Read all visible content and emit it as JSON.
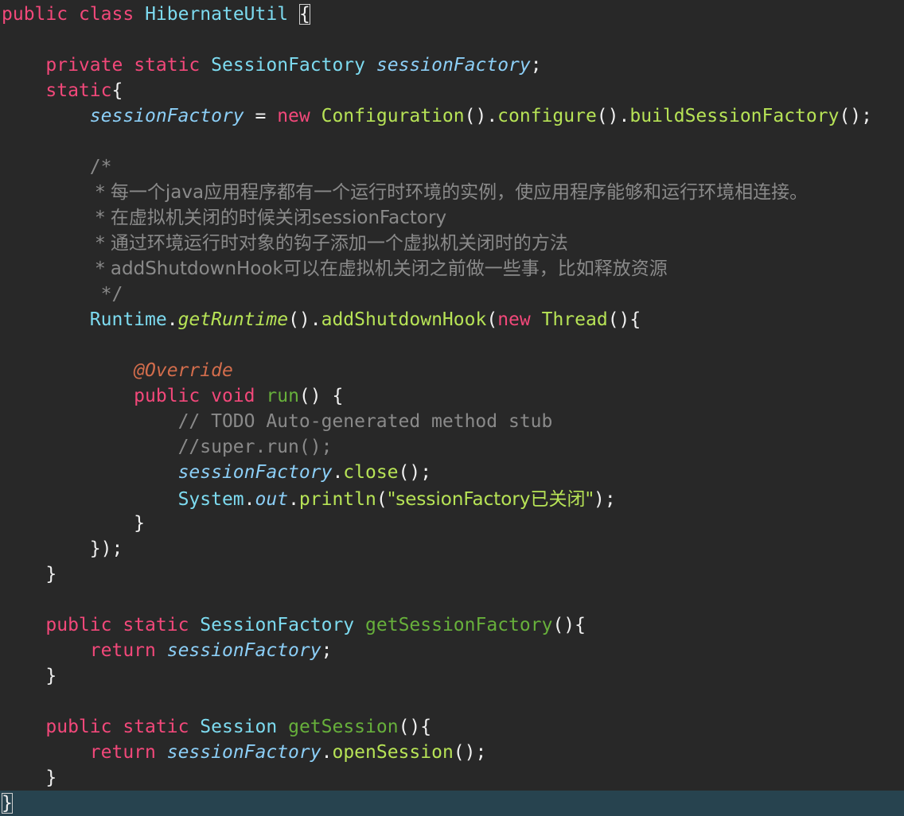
{
  "colors": {
    "background": "#282828",
    "current_line": "#27434f",
    "keyword": "#f2487a",
    "type": "#7ddbf0",
    "function": "#b7e356",
    "field": "#8ccff7",
    "comment": "#8a8a8a",
    "annotation": "#d36d4c"
  },
  "code": {
    "l1": {
      "public": "public",
      "class": "class",
      "name": "HibernateUtil",
      "brace": "{"
    },
    "l3": {
      "private": "private",
      "static": "static",
      "type": "SessionFactory",
      "var": "sessionFactory",
      "end": ";"
    },
    "l4": {
      "static": "static",
      "brace": "{"
    },
    "l5": {
      "var": "sessionFactory",
      "eq": " = ",
      "new": "new",
      "cls": "Configuration",
      "p1": "().",
      "m1": "configure",
      "p2": "().",
      "m2": "buildSessionFactory",
      "p3": "();"
    },
    "l7": "/*",
    "l8": " * 每一个java应用程序都有一个运行时环境的实例，使应用程序能够和运行环境相连接。",
    "l9": " * 在虚拟机关闭的时候关闭sessionFactory",
    "l10": " * 通过环境运行时对象的钩子添加一个虚拟机关闭时的方法",
    "l11": " * addShutdownHook可以在虚拟机关闭之前做一些事，比如释放资源",
    "l12": " */",
    "l13": {
      "cls": "Runtime",
      "dot": ".",
      "m1": "getRuntime",
      "p1": "().",
      "m2": "addShutdownHook",
      "p2": "(",
      "new": "new",
      "thread": "Thread",
      "p3": "(){"
    },
    "l15": "@Override",
    "l16": {
      "public": "public",
      "void": "void",
      "m": "run",
      "p": "() {"
    },
    "l17": "// TODO Auto-generated method stub",
    "l18": "//super.run();",
    "l19": {
      "var": "sessionFactory",
      "dot": ".",
      "m": "close",
      "p": "();"
    },
    "l20": {
      "cls": "System",
      "dot1": ".",
      "out": "out",
      "dot2": ".",
      "m": "println",
      "p1": "(",
      "str": "\"sessionFactory已关闭\"",
      "p2": ");"
    },
    "l21": "}",
    "l22": "});",
    "l23": "}",
    "l25": {
      "public": "public",
      "static": "static",
      "type": "SessionFactory",
      "m": "getSessionFactory",
      "p": "(){"
    },
    "l26": {
      "return": "return",
      "var": "sessionFactory",
      "end": ";"
    },
    "l27": "}",
    "l29": {
      "public": "public",
      "static": "static",
      "type": "Session",
      "m": "getSession",
      "p": "(){"
    },
    "l30": {
      "return": "return",
      "var": "sessionFactory",
      "dot": ".",
      "m": "openSession",
      "p": "();"
    },
    "l31": "}",
    "l32": "}"
  }
}
